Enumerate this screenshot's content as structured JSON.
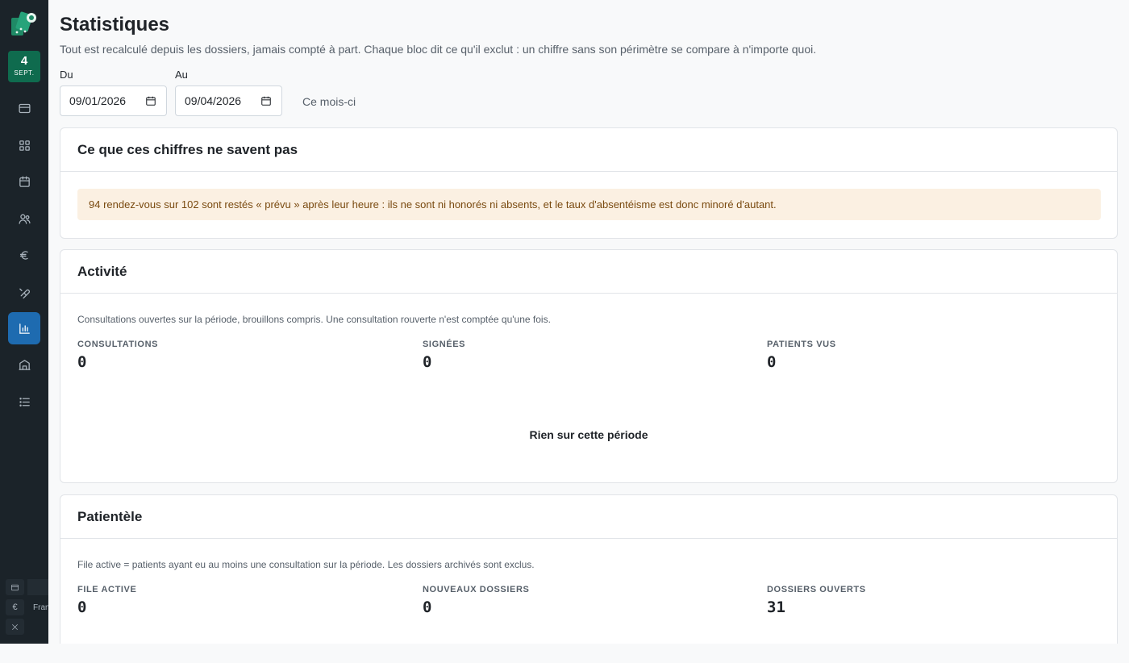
{
  "nav": {
    "date_day": "4",
    "date_month": "SEPT.",
    "items": [
      {
        "icon": "card-icon",
        "active": false
      },
      {
        "icon": "grid-icon",
        "active": false
      },
      {
        "icon": "calendar-icon",
        "active": false
      },
      {
        "icon": "users-icon",
        "active": false
      },
      {
        "icon": "euro-icon",
        "active": false
      },
      {
        "icon": "pill-icon",
        "active": false
      },
      {
        "icon": "chart-icon",
        "active": true
      },
      {
        "icon": "building-icon",
        "active": false
      },
      {
        "icon": "list-icon",
        "active": false
      }
    ],
    "bottom_currency": "€",
    "bottom_text": "Fran"
  },
  "page": {
    "title": "Statistiques",
    "subtitle": "Tout est recalculé depuis les dossiers, jamais compté à part. Chaque bloc dit ce qu'il exclut : un chiffre sans son périmètre se compare à n'importe quoi."
  },
  "filters": {
    "from_label": "Du",
    "from_value": "09/01/2026",
    "to_label": "Au",
    "to_value": "09/04/2026",
    "this_month": "Ce mois-ci"
  },
  "caveats": {
    "title": "Ce que ces chiffres ne savent pas",
    "warning": "94 rendez-vous sur 102 sont restés « prévu » après leur heure : ils ne sont ni honorés ni absents, et le taux d'absentéisme est donc minoré d'autant."
  },
  "activity": {
    "title": "Activité",
    "note": "Consultations ouvertes sur la période, brouillons compris. Une consultation rouverte n'est comptée qu'une fois.",
    "stats": [
      {
        "label": "CONSULTATIONS",
        "value": "0"
      },
      {
        "label": "SIGNÉES",
        "value": "0"
      },
      {
        "label": "PATIENTS VUS",
        "value": "0"
      }
    ],
    "empty": "Rien sur cette période"
  },
  "patients": {
    "title": "Patientèle",
    "note": "File active = patients ayant eu au moins une consultation sur la période. Les dossiers archivés sont exclus.",
    "stats": [
      {
        "label": "FILE ACTIVE",
        "value": "0"
      },
      {
        "label": "NOUVEAUX DOSSIERS",
        "value": "0"
      },
      {
        "label": "DOSSIERS OUVERTS",
        "value": "31"
      }
    ]
  }
}
